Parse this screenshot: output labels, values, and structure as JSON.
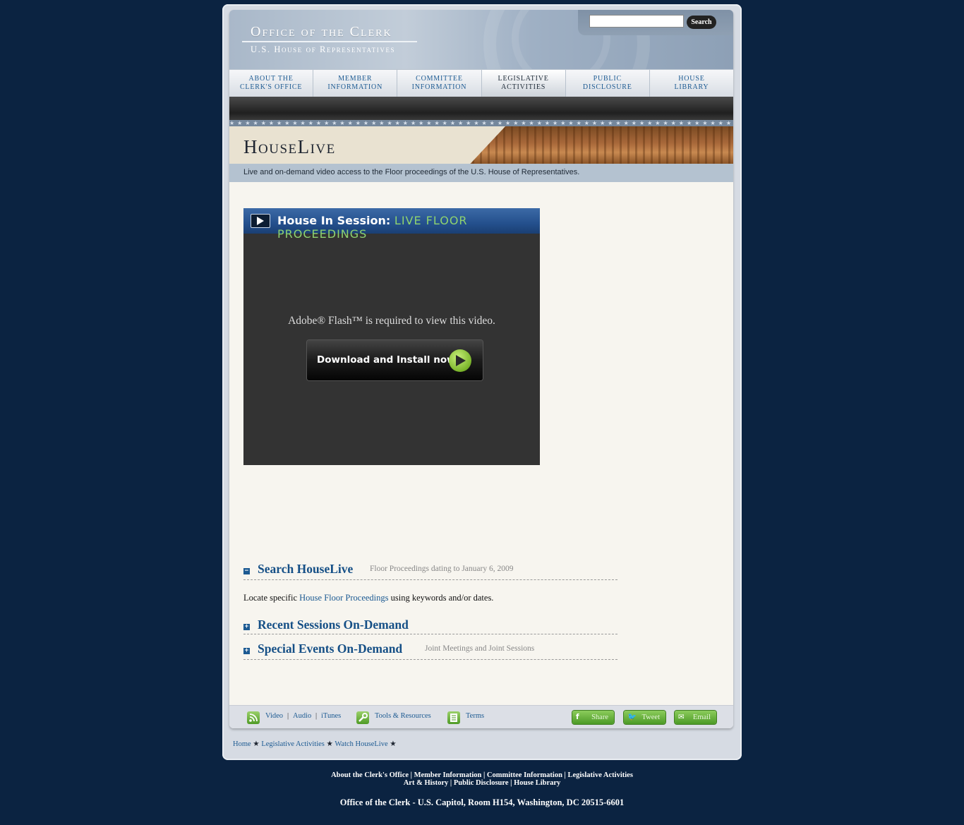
{
  "header": {
    "title": "Office of the Clerk",
    "subtitle": "U.S. House of Representatives",
    "search_button": "Search",
    "search_value": ""
  },
  "nav": [
    {
      "line1": "About the",
      "line2": "Clerk's Office"
    },
    {
      "line1": "Member",
      "line2": "Information"
    },
    {
      "line1": "Committee",
      "line2": "Information"
    },
    {
      "line1": "Legislative",
      "line2": "Activities",
      "active": true
    },
    {
      "line1": "Public",
      "line2": "Disclosure"
    },
    {
      "line1": "House",
      "line2": "Library"
    }
  ],
  "banner": {
    "title": "HouseLive",
    "description": "Live and on-demand video access to the Floor proceedings of the U.S. House of Representatives."
  },
  "player": {
    "title": "House In Session:",
    "title_highlight": "LIVE FLOOR PROCEEDINGS",
    "flash_message": "Adobe® Flash™ is required to view this video.",
    "install_button": "Download and Install now"
  },
  "sections": {
    "search": {
      "icon": "−",
      "title": "Search HouseLive",
      "note": "Floor Proceedings dating to January 6, 2009"
    },
    "body": {
      "prefix": "Locate specific",
      "link": "House Floor Proceedings",
      "suffix": "using keywords and/or dates."
    },
    "recent": {
      "icon": "+",
      "title": "Recent Sessions On-Demand",
      "note": ""
    },
    "special": {
      "icon": "+",
      "title": "Special Events On-Demand",
      "note": "Joint Meetings and Joint Sessions"
    }
  },
  "footbar": {
    "video": "Video",
    "audio": "Audio",
    "itunes": "iTunes",
    "sep": "|",
    "tools": "Tools & Resources",
    "terms": "Terms",
    "share": "Share",
    "tweet": "Tweet",
    "email": "Email"
  },
  "breadcrumb": {
    "home": "Home",
    "legislative": "Legislative Activities",
    "current": "Watch HouseLive",
    "sep": "★"
  },
  "footer": {
    "links_line1": "About the Clerk's Office | Member Information | Committee Information | Legislative Activities",
    "links_line2": "Art & History | Public Disclosure | House Library",
    "address": "Office of the Clerk - U.S. Capitol, Room H154, Washington, DC 20515-6601"
  },
  "colors": {
    "page_bg": "#0b2341",
    "link": "#1c5a92",
    "accent_green": "#8fd36f"
  }
}
